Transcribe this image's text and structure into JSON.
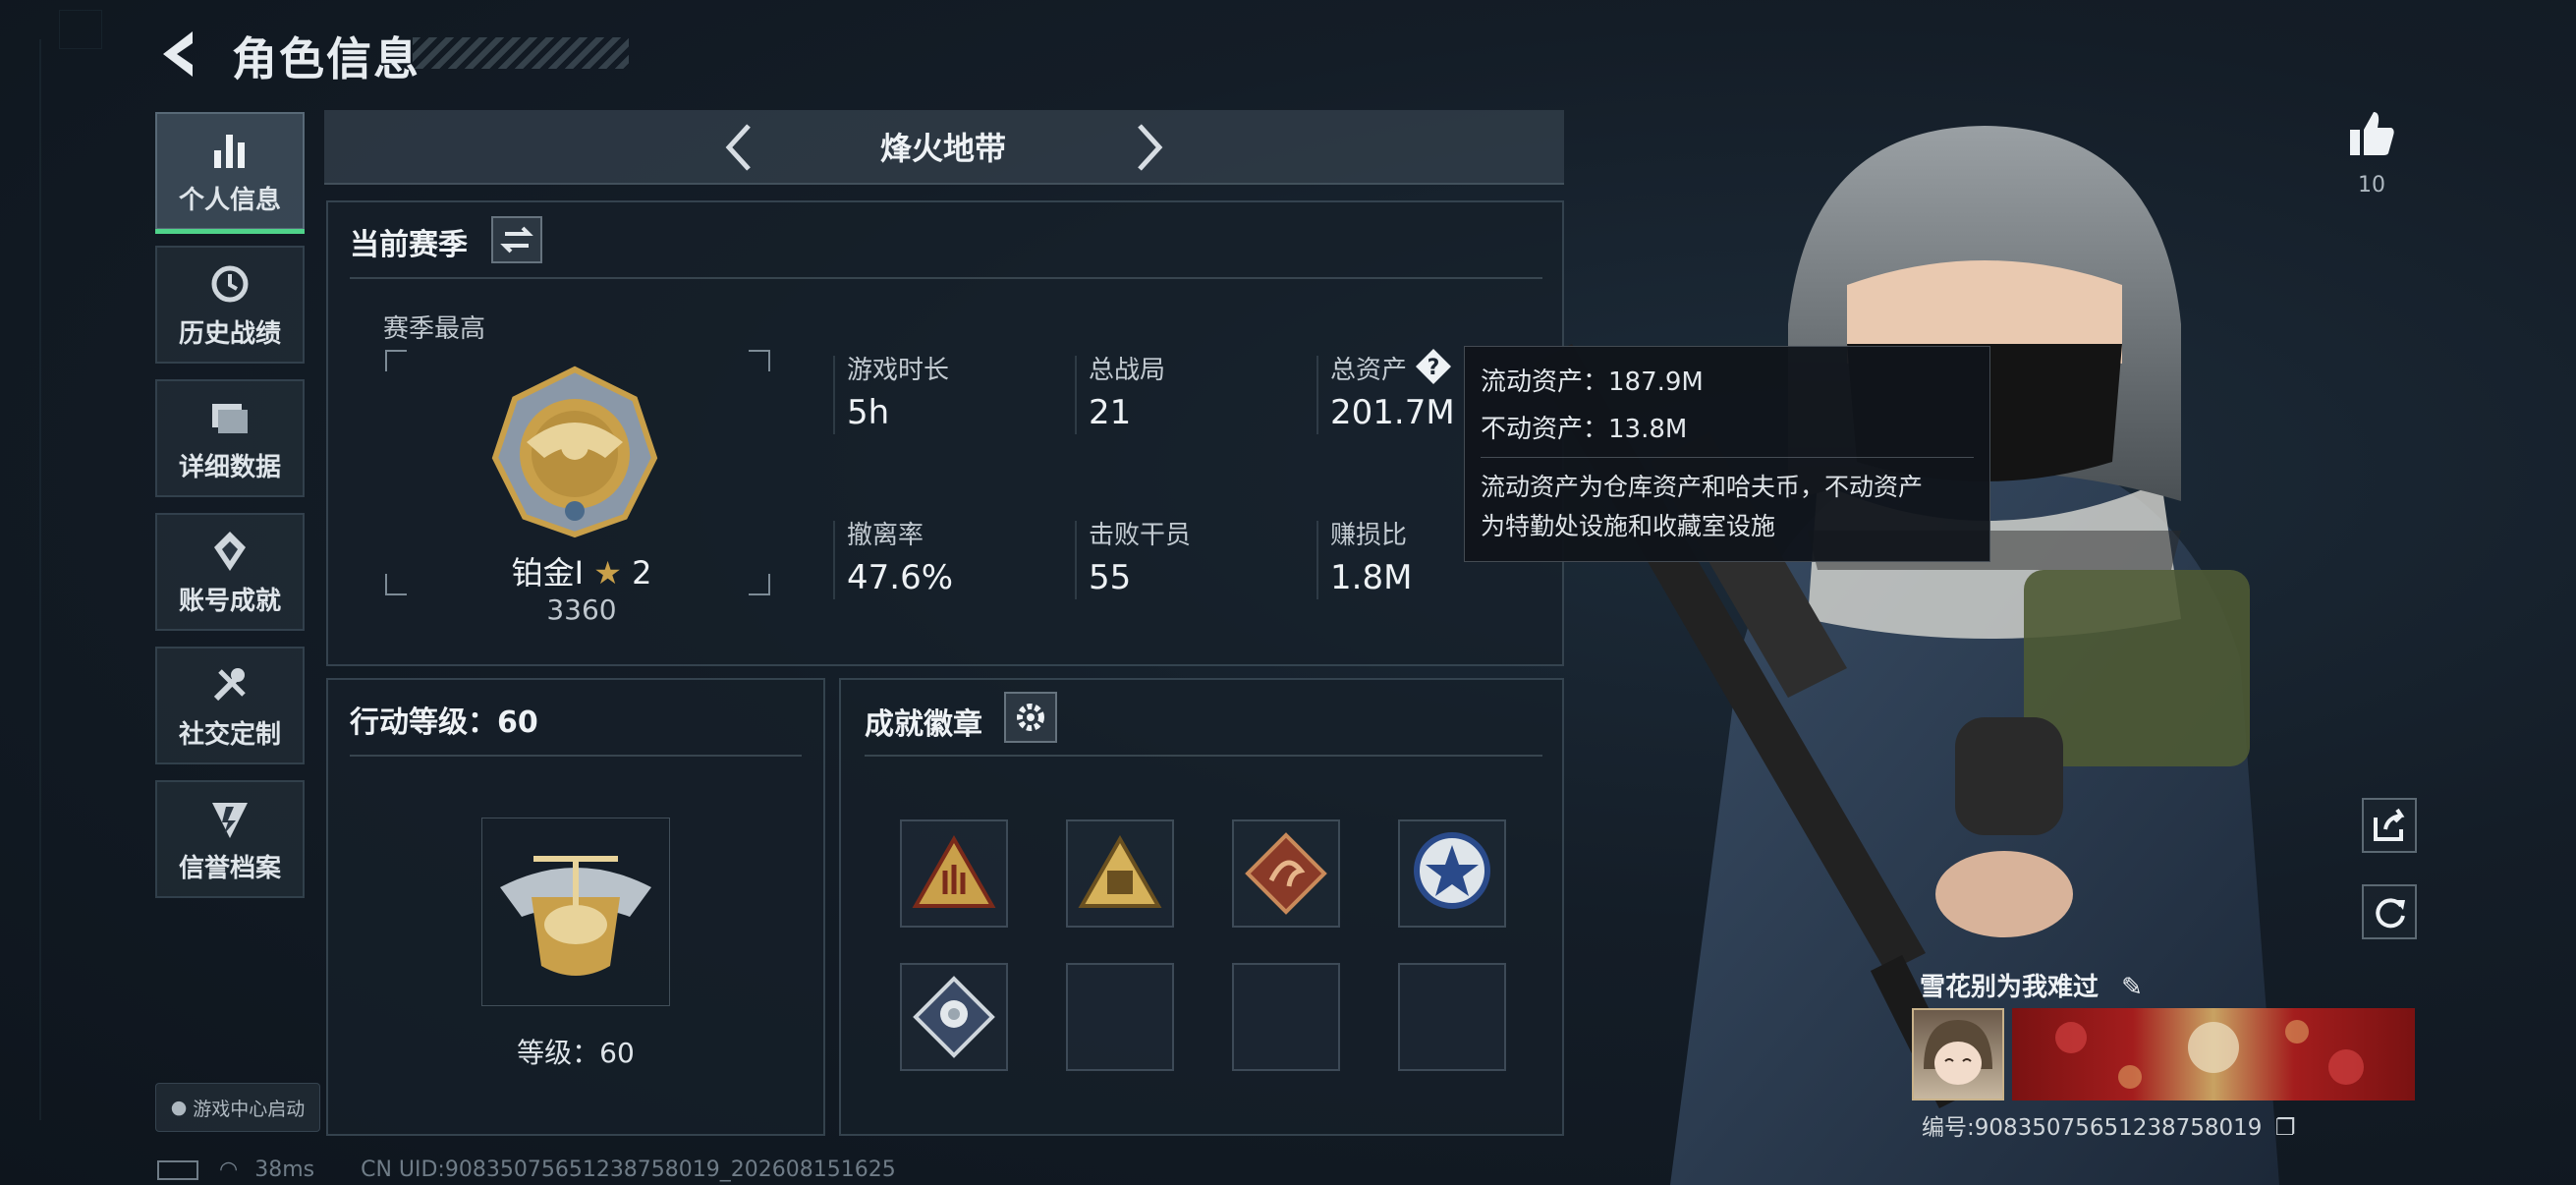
{
  "header": {
    "title": "角色信息"
  },
  "sidebar": {
    "items": [
      {
        "label": "个人信息",
        "icon": "bar-chart-icon",
        "active": true
      },
      {
        "label": "历史战绩",
        "icon": "history-icon"
      },
      {
        "label": "详细数据",
        "icon": "folder-icon"
      },
      {
        "label": "账号成就",
        "icon": "achievement-icon"
      },
      {
        "label": "社交定制",
        "icon": "tools-icon"
      },
      {
        "label": "信誉档案",
        "icon": "credit-icon"
      }
    ],
    "launch_label": "游戏中心启动"
  },
  "mode": {
    "title": "烽火地带"
  },
  "season": {
    "section_title": "当前赛季",
    "best_label": "赛季最高",
    "rank_name": "铂金Ⅰ",
    "rank_stars": "2",
    "rank_points": "3360",
    "stats": [
      {
        "label": "游戏时长",
        "value": "5h"
      },
      {
        "label": "总战局",
        "value": "21"
      },
      {
        "label": "总资产",
        "value": "201.7M"
      },
      {
        "label": "撤离率",
        "value": "47.6%"
      },
      {
        "label": "击败干员",
        "value": "55"
      },
      {
        "label": "赚损比",
        "value": "1.8M"
      }
    ]
  },
  "tooltip": {
    "liquid": "流动资产：187.9M",
    "fixed": "不动资产：13.8M",
    "desc_line1": "流动资产为仓库资产和哈夫币，不动资产",
    "desc_line2": "为特勤处设施和收藏室设施"
  },
  "level": {
    "title": "行动等级：60",
    "label": "等级：60"
  },
  "badges": {
    "title": "成就徽章",
    "filled": 5,
    "total": 8
  },
  "profile": {
    "likes": "10",
    "name": "雪花别为我难过",
    "uid": "编号:90835075651238758019"
  },
  "status": {
    "ping": "38ms",
    "uid_line": "CN UID:90835075651238758019_202608151625"
  },
  "colors": {
    "accent": "#4fd38a",
    "gold": "#c9a04a"
  }
}
